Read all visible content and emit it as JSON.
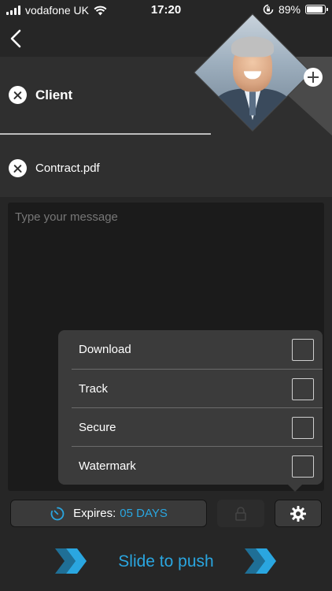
{
  "status_bar": {
    "carrier": "vodafone UK",
    "time": "17:20",
    "battery": "89%",
    "battery_level": 0.89
  },
  "header": {
    "client_label": "Client",
    "file_label": "Contract.pdf"
  },
  "message": {
    "placeholder": "Type your message"
  },
  "options": {
    "items": [
      {
        "label": "Download",
        "checked": false
      },
      {
        "label": "Track",
        "checked": false
      },
      {
        "label": "Secure",
        "checked": false
      },
      {
        "label": "Watermark",
        "checked": false
      }
    ]
  },
  "toolbar": {
    "expires_label": "Expires:",
    "expires_value": "05 DAYS"
  },
  "slide": {
    "label": "Slide to push"
  },
  "colors": {
    "accent": "#2aa6e0",
    "background": "#262626",
    "panel": "#3b3b3b"
  }
}
